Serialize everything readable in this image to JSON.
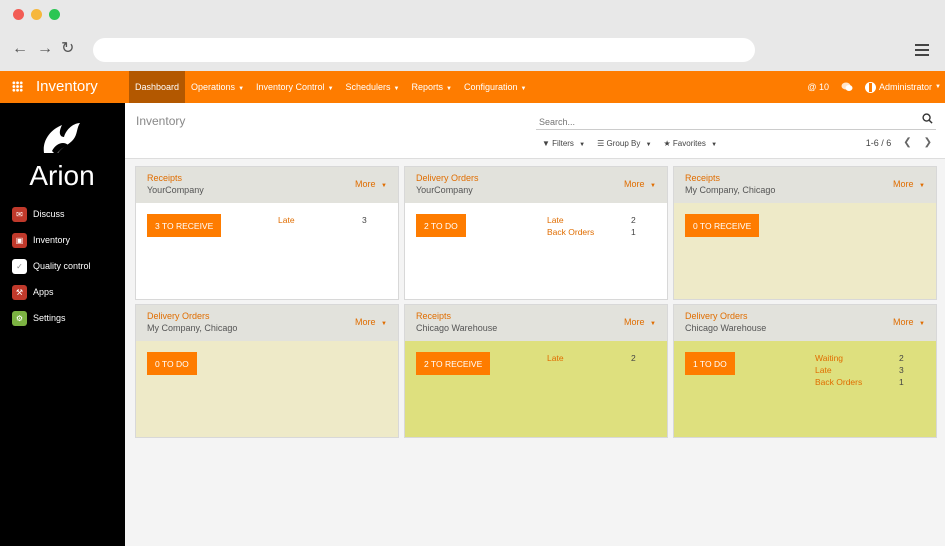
{
  "topbar": {
    "brand": "Inventory",
    "menu": [
      {
        "label": "Dashboard",
        "active": true,
        "caret": false
      },
      {
        "label": "Operations",
        "caret": true
      },
      {
        "label": "Inventory Control",
        "caret": true
      },
      {
        "label": "Schedulers",
        "caret": true
      },
      {
        "label": "Reports",
        "caret": true
      },
      {
        "label": "Configuration",
        "caret": true
      }
    ],
    "notifications": "@ 10",
    "user": "Administrator"
  },
  "sidebar": {
    "logo_text": "Arion",
    "items": [
      {
        "label": "Discuss",
        "icon": "discuss-icon",
        "color": "#c0392b"
      },
      {
        "label": "Inventory",
        "icon": "inventory-icon",
        "color": "#c0392b"
      },
      {
        "label": "Quality control",
        "icon": "quality-control-icon",
        "color": "#ffffff"
      },
      {
        "label": "Apps",
        "icon": "apps-icon",
        "color": "#c0392b"
      },
      {
        "label": "Settings",
        "icon": "settings-icon",
        "color": "#7cb342"
      }
    ]
  },
  "control": {
    "breadcrumb": "Inventory",
    "search_placeholder": "Search...",
    "filters_label": "Filters",
    "groupby_label": "Group By",
    "favorites_label": "Favorites",
    "pager": "1-6 / 6"
  },
  "colors": {
    "accent": "#fe7c00",
    "accent_dark": "#b35800",
    "card_beige": "#eeeac8",
    "card_yellow": "#dee07e"
  },
  "cards": [
    {
      "title": "Receipts",
      "company": "YourCompany",
      "more": "More",
      "button": "3 TO RECEIVE",
      "bg": "white",
      "stats": [
        {
          "label": "Late",
          "value": "3"
        }
      ]
    },
    {
      "title": "Delivery Orders",
      "company": "YourCompany",
      "more": "More",
      "button": "2 TO DO",
      "bg": "white",
      "stats": [
        {
          "label": "Late",
          "value": "2"
        },
        {
          "label": "Back Orders",
          "value": "1"
        }
      ]
    },
    {
      "title": "Receipts",
      "company": "My Company, Chicago",
      "more": "More",
      "button": "0 TO RECEIVE",
      "bg": "beige",
      "stats": []
    },
    {
      "title": "Delivery Orders",
      "company": "My Company, Chicago",
      "more": "More",
      "button": "0 TO DO",
      "bg": "beige",
      "stats": []
    },
    {
      "title": "Receipts",
      "company": "Chicago Warehouse",
      "more": "More",
      "button": "2 TO RECEIVE",
      "bg": "yellow",
      "stats": [
        {
          "label": "Late",
          "value": "2"
        }
      ]
    },
    {
      "title": "Delivery Orders",
      "company": "Chicago Warehouse",
      "more": "More",
      "button": "1 TO DO",
      "bg": "yellow",
      "stats": [
        {
          "label": "Waiting",
          "value": "2"
        },
        {
          "label": "Late",
          "value": "3"
        },
        {
          "label": "Back Orders",
          "value": "1"
        }
      ]
    }
  ]
}
